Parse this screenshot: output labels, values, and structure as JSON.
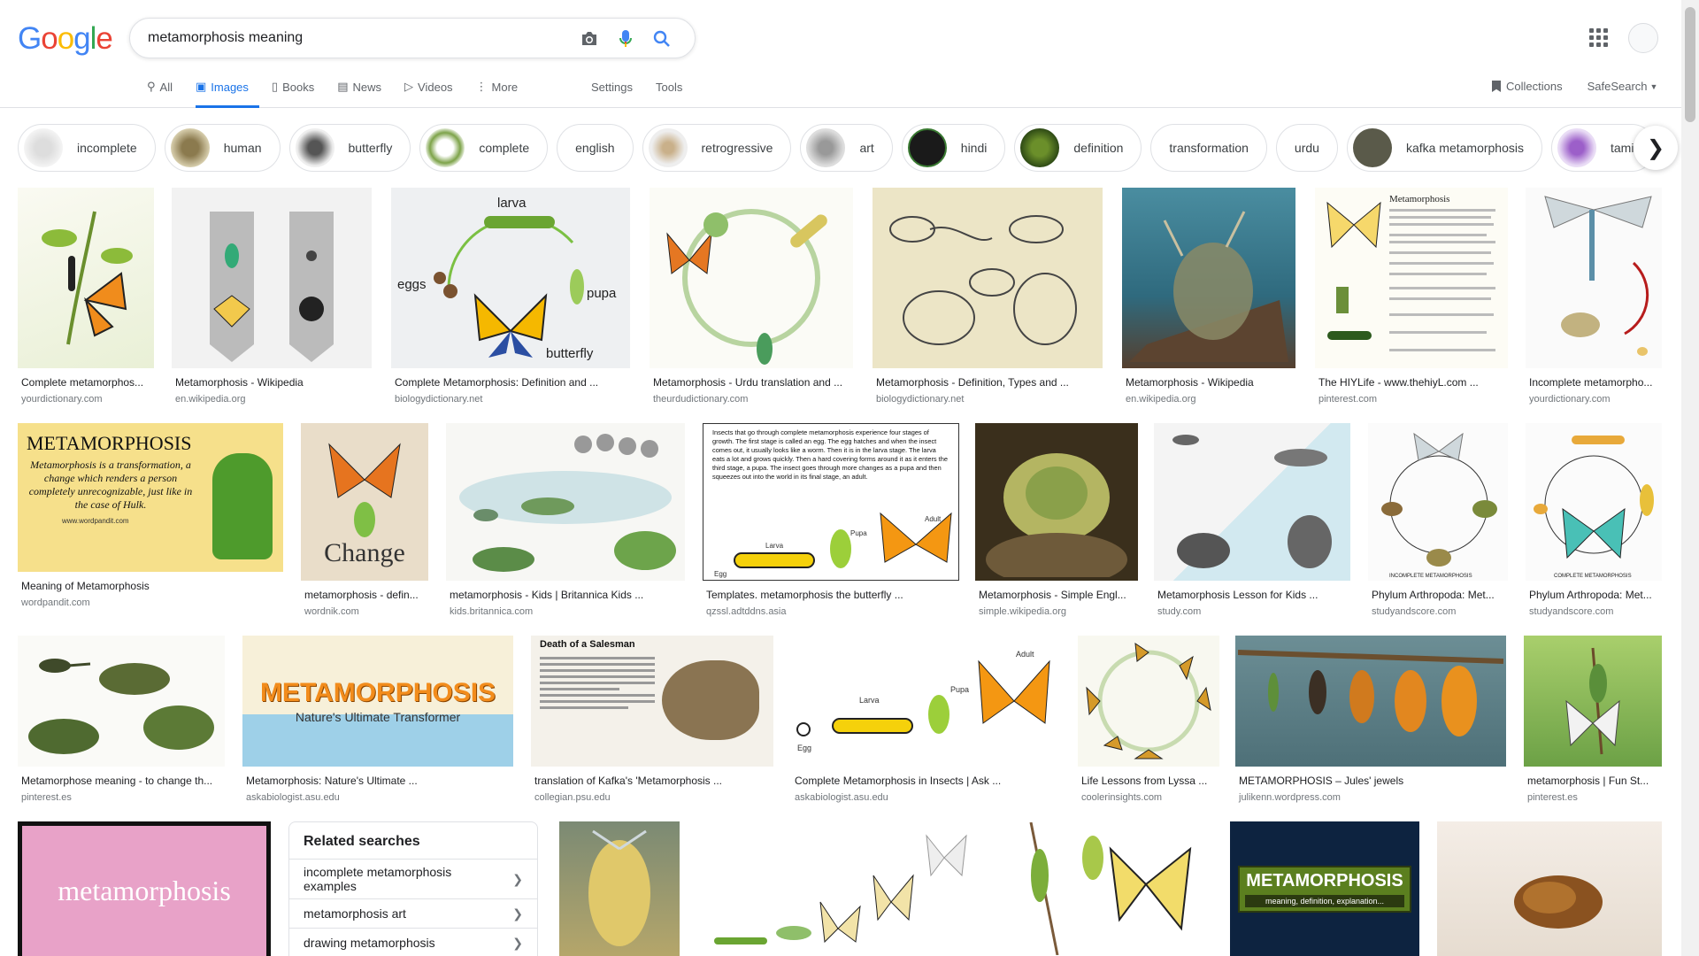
{
  "logo": {
    "text": "Google"
  },
  "search": {
    "query": "metamorphosis meaning",
    "placeholder": ""
  },
  "tabs": [
    {
      "label": "All",
      "icon": "search-icon"
    },
    {
      "label": "Images",
      "icon": "image-icon",
      "active": true
    },
    {
      "label": "Books",
      "icon": "book-icon"
    },
    {
      "label": "News",
      "icon": "news-icon"
    },
    {
      "label": "Videos",
      "icon": "video-icon"
    },
    {
      "label": "More",
      "icon": "kebab-icon"
    }
  ],
  "tools": {
    "settings": "Settings",
    "tools": "Tools"
  },
  "right": {
    "collections": "Collections",
    "safesearch": "SafeSearch"
  },
  "chips": [
    "incomplete",
    "human",
    "butterfly",
    "complete",
    "english",
    "retrogressive",
    "art",
    "hindi",
    "definition",
    "transformation",
    "urdu",
    "kafka metamorphosis",
    "tamil"
  ],
  "rows": [
    [
      {
        "caption": "Complete metamorphos...",
        "source": "yourdictionary.com"
      },
      {
        "caption": "Metamorphosis - Wikipedia",
        "source": "en.wikipedia.org"
      },
      {
        "caption": "Complete Metamorphosis: Definition and ...",
        "source": "biologydictionary.net",
        "labels": [
          "larva",
          "eggs",
          "pupa",
          "butterfly"
        ]
      },
      {
        "caption": "Metamorphosis - Urdu translation and ...",
        "source": "theurdudictionary.com"
      },
      {
        "caption": "Metamorphosis - Definition, Types and ...",
        "source": "biologydictionary.net"
      },
      {
        "caption": "Metamorphosis - Wikipedia",
        "source": "en.wikipedia.org"
      },
      {
        "caption": "The HIYLife - www.thehiyL.com ...",
        "source": "pinterest.com",
        "labels": [
          "Metamorphosis"
        ]
      },
      {
        "caption": "Incomplete metamorpho...",
        "source": "yourdictionary.com"
      }
    ],
    [
      {
        "caption": "Meaning of Metamorphosis",
        "source": "wordpandit.com",
        "labels": [
          "METAMORPHOSIS",
          "Metamorphosis is a transformation, a change which renders a person completely unrecognizable, just like in the case of Hulk.",
          "www.wordpandit.com"
        ]
      },
      {
        "caption": "metamorphosis - defin...",
        "source": "wordnik.com",
        "labels": [
          "Change"
        ]
      },
      {
        "caption": "metamorphosis - Kids | Britannica Kids ...",
        "source": "kids.britannica.com"
      },
      {
        "caption": "Templates. metamorphosis the butterfly ...",
        "source": "qzssl.adtddns.asia",
        "labels": [
          "Insects that go through complete metamorphosis experience four stages of growth. The first stage is called an egg. The egg hatches and when the insect comes out, it usually looks like a worm. Then it is in the larva stage. The larva eats a lot and grows quickly. Then a hard covering forms around it as it enters the third stage, a pupa. The insect goes through more changes as a pupa and then squeezes out into the world in its final stage, an adult.",
          "Egg",
          "Larva",
          "Pupa",
          "Adult"
        ]
      },
      {
        "caption": "Metamorphosis - Simple Engl...",
        "source": "simple.wikipedia.org"
      },
      {
        "caption": "Metamorphosis Lesson for Kids ...",
        "source": "study.com"
      },
      {
        "caption": "Phylum Arthropoda: Met...",
        "source": "studyandscore.com",
        "labels": [
          "INCOMPLETE METAMORPHOSIS"
        ]
      },
      {
        "caption": "Phylum Arthropoda: Met...",
        "source": "studyandscore.com",
        "labels": [
          "COMPLETE METAMORPHOSIS"
        ]
      }
    ],
    [
      {
        "caption": "Metamorphose meaning - to change th...",
        "source": "pinterest.es"
      },
      {
        "caption": "Metamorphosis: Nature's Ultimate ...",
        "source": "askabiologist.asu.edu",
        "labels": [
          "METAMORPHOSIS",
          "Nature's Ultimate Transformer"
        ]
      },
      {
        "caption": "translation of Kafka's 'Metamorphosis ...",
        "source": "collegian.psu.edu",
        "labels": [
          "Death of a Salesman"
        ]
      },
      {
        "caption": "Complete Metamorphosis in Insects | Ask ...",
        "source": "askabiologist.asu.edu",
        "labels": [
          "Egg",
          "Larva",
          "Pupa",
          "Adult"
        ]
      },
      {
        "caption": "Life Lessons from Lyssa ...",
        "source": "coolerinsights.com"
      },
      {
        "caption": "METAMORPHOSIS – Jules' jewels",
        "source": "julikenn.wordpress.com"
      },
      {
        "caption": "metamorphosis | Fun St...",
        "source": "pinterest.es"
      }
    ]
  ],
  "bottom": {
    "pink_tile_text": "metamorphosis",
    "green_tile_title": "METAMORPHOSIS",
    "green_tile_sub": "meaning, definition, explanation..."
  },
  "related": {
    "title": "Related searches",
    "items": [
      "incomplete metamorphosis examples",
      "metamorphosis art",
      "drawing metamorphosis"
    ]
  },
  "colors": {
    "accent": "#1a73e8",
    "google_blue": "#4285f4",
    "google_red": "#ea4335",
    "google_yellow": "#fbbc05",
    "google_green": "#34a853"
  }
}
